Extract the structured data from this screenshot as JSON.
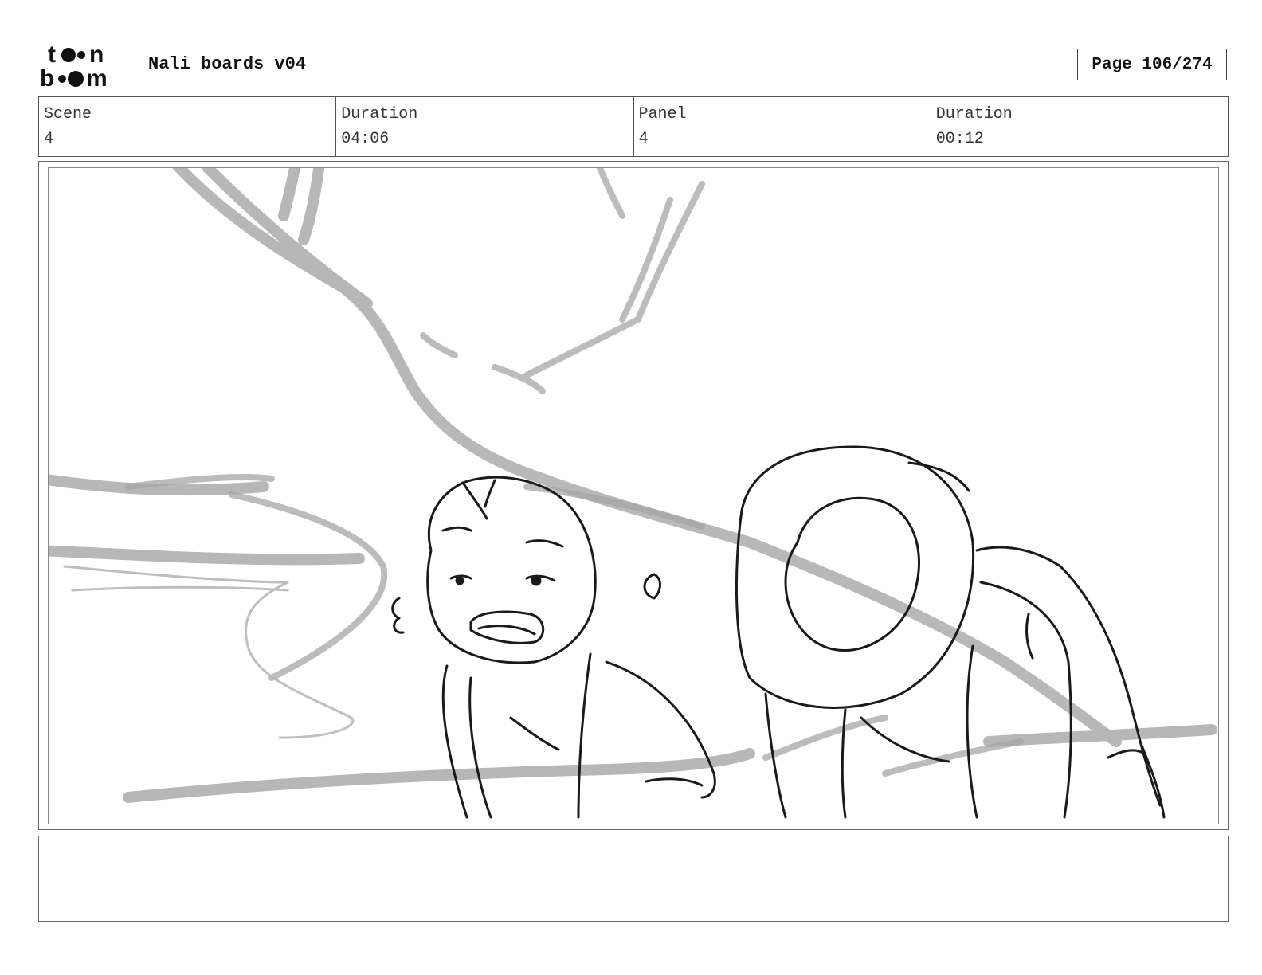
{
  "header": {
    "logo": {
      "line1": "toon",
      "line2": "boom",
      "icon": "toon-boom-logo"
    },
    "title": "Nali boards v04",
    "page_label": "Page 106/274"
  },
  "info": {
    "scene_label": "Scene",
    "scene_value": "4",
    "scene_duration_label": "Duration",
    "scene_duration_value": "04:06",
    "panel_label": "Panel",
    "panel_value": "4",
    "panel_duration_label": "Duration",
    "panel_duration_value": "00:12"
  },
  "panel": {
    "image": "storyboard-sketch-two-characters-under-tree"
  },
  "notes": {
    "text": ""
  }
}
